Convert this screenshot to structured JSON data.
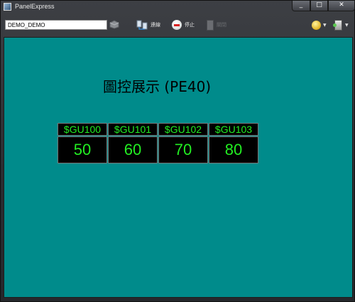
{
  "window": {
    "title": "PanelExpress"
  },
  "window_controls": {
    "minimize": "_",
    "maximize": "□",
    "close": "✕"
  },
  "toolbar": {
    "project_name": "DEMO_DEMO",
    "connect_label": "連線",
    "stop_label": "停止",
    "extra_label": "關閉"
  },
  "panel": {
    "title": "圖控展示 (PE40)",
    "tags": [
      {
        "name": "$GU100",
        "value": "50"
      },
      {
        "name": "$GU101",
        "value": "60"
      },
      {
        "name": "$GU102",
        "value": "70"
      },
      {
        "name": "$GU103",
        "value": "80"
      }
    ]
  },
  "colors": {
    "panel_bg": "#008b8b",
    "tag_text": "#22ee22",
    "tag_bg": "#000000"
  }
}
